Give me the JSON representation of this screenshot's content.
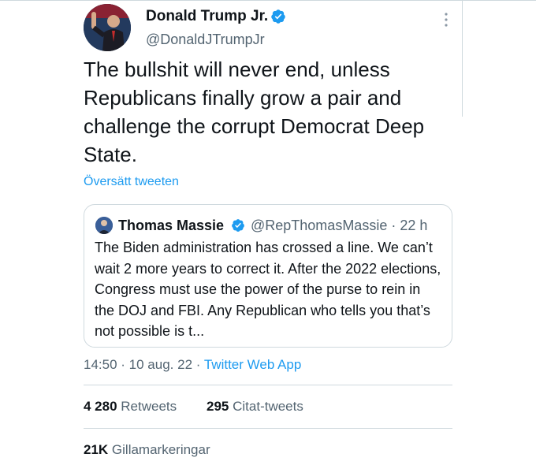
{
  "tweet": {
    "author_name": "Donald Trump Jr.",
    "author_handle": "@DonaldJTrumpJr",
    "text": "The bullshit will never end, unless Republicans finally grow a pair and challenge the corrupt Democrat Deep State.",
    "translate_label": "Översätt tweeten",
    "time": "14:50",
    "date": "10 aug. 22",
    "source": "Twitter Web App",
    "retweets_count": "4 280",
    "retweets_label": "Retweets",
    "quotes_count": "295",
    "quotes_label": "Citat-tweets",
    "likes_count": "21K",
    "likes_label": "Gillamarkeringar"
  },
  "quoted": {
    "author_name": "Thomas Massie",
    "author_handle": "@RepThomasMassie",
    "age": "22 h",
    "text": "The Biden administration has crossed a line. We can’t wait 2 more years to correct it. After the 2022 elections, Congress must use the power of the purse to rein in the DOJ and FBI. Any Republican who tells you that’s not possible is t..."
  },
  "icons": {
    "verified": "verified-badge-icon",
    "more": "more-options-icon"
  },
  "colors": {
    "link": "#1d9bf0",
    "secondary_text": "#536471",
    "border": "#cfd9de"
  }
}
